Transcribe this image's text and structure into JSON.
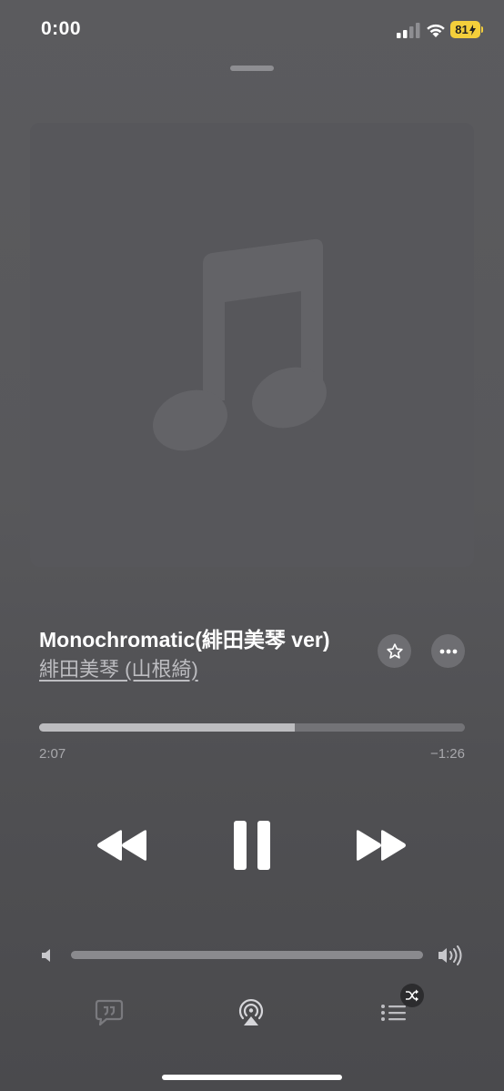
{
  "status_bar": {
    "time": "0:00",
    "battery_level": "81"
  },
  "now_playing": {
    "title": "Monochromatic(緋田美琴 ver)",
    "artist": "緋田美琴 (山根綺)",
    "elapsed": "2:07",
    "remaining": "−1:26",
    "progress_fraction": 0.6,
    "volume_fraction": 1.0
  },
  "icons": {
    "artwork": "music-note-icon",
    "favorite": "star-icon",
    "more": "ellipsis-icon",
    "rewind": "backward-icon",
    "pause": "pause-icon",
    "forward": "forward-icon",
    "volume_low": "speaker-low-icon",
    "volume_high": "speaker-high-icon",
    "lyrics": "quote-bubble-icon",
    "airplay": "airplay-icon",
    "queue": "list-icon",
    "shuffle": "shuffle-icon"
  },
  "colors": {
    "battery": "#f4cf3b",
    "background": "#58585b"
  }
}
